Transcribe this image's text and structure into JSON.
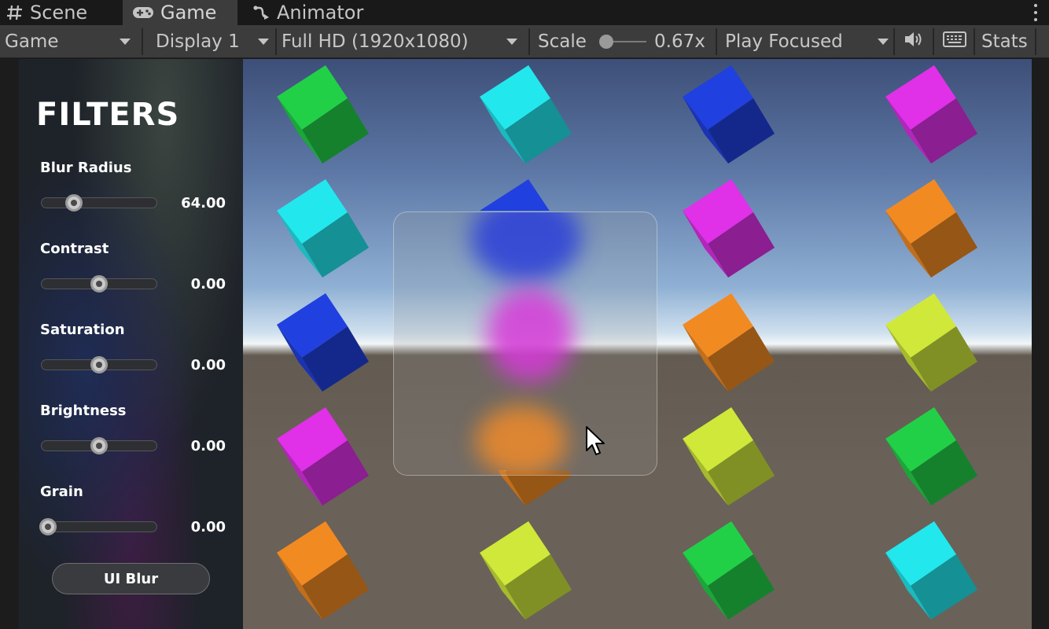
{
  "tabs": [
    {
      "label": "Scene",
      "icon": "grid-icon",
      "active": false
    },
    {
      "label": "Game",
      "icon": "gamepad-icon",
      "active": true
    },
    {
      "label": "Animator",
      "icon": "animator-icon",
      "active": false
    }
  ],
  "toolbar": {
    "view_mode": "Game",
    "display": "Display 1",
    "resolution": "Full HD (1920x1080)",
    "scale_label": "Scale",
    "scale_value": "0.67x",
    "play_mode": "Play Focused",
    "stats_label": "Stats"
  },
  "filters": {
    "title": "FILTERS",
    "items": [
      {
        "label": "Blur Radius",
        "value": "64.00",
        "fraction": 0.25
      },
      {
        "label": "Contrast",
        "value": "0.00",
        "fraction": 0.5
      },
      {
        "label": "Saturation",
        "value": "0.00",
        "fraction": 0.5
      },
      {
        "label": "Brightness",
        "value": "0.00",
        "fraction": 0.5
      },
      {
        "label": "Grain",
        "value": "0.00",
        "fraction": 0.0
      }
    ],
    "button_label": "UI Blur"
  },
  "colors": {
    "green": "#22d048",
    "cyan": "#22e8ee",
    "blue": "#2040e0",
    "magenta": "#e030e8",
    "orange": "#f28a22",
    "yellow": "#d0e83a"
  },
  "cube_grid": [
    [
      "green",
      "cyan",
      "blue",
      "magenta"
    ],
    [
      "cyan",
      "blue",
      "magenta",
      "orange"
    ],
    [
      "blue",
      "magenta",
      "orange",
      "yellow"
    ],
    [
      "magenta",
      "orange",
      "yellow",
      "green"
    ],
    [
      "orange",
      "yellow",
      "green",
      "cyan"
    ]
  ]
}
